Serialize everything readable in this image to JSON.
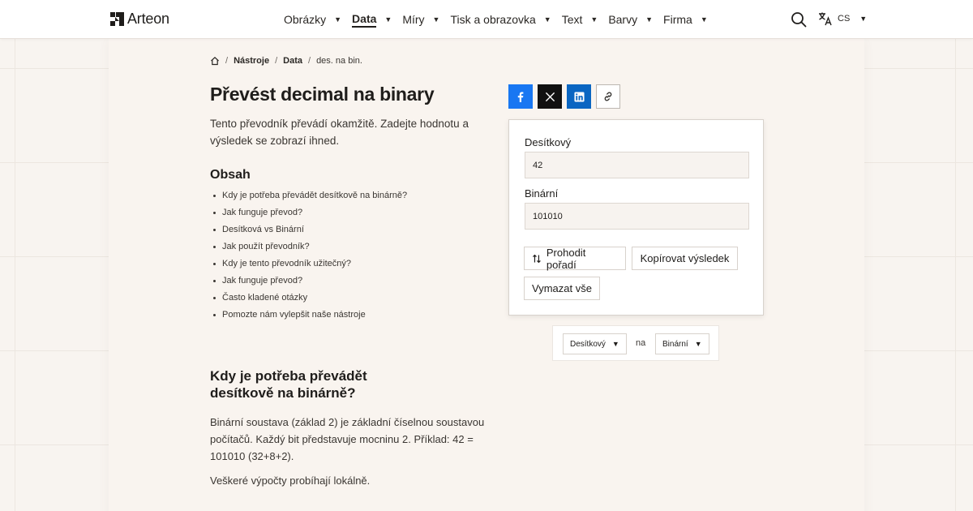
{
  "brand": {
    "name": "Arteon"
  },
  "nav": {
    "items": [
      {
        "label": "Obrázky",
        "active": false
      },
      {
        "label": "Data",
        "active": true
      },
      {
        "label": "Míry",
        "active": false
      },
      {
        "label": "Tisk a obrazovka",
        "active": false
      },
      {
        "label": "Text",
        "active": false
      },
      {
        "label": "Barvy",
        "active": false
      },
      {
        "label": "Firma",
        "active": false
      }
    ],
    "caret": "▼"
  },
  "lang": {
    "code": "CS",
    "caret": "▼"
  },
  "breadcrumb": {
    "sep": "/",
    "items": [
      "Nástroje",
      "Data"
    ],
    "current": "des. na bin."
  },
  "page": {
    "title": "Převést decimal na binary",
    "intro": "Tento převodník převádí okamžitě. Zadejte hodnotu a výsledek se zobrazí ihned."
  },
  "toc": {
    "heading": "Obsah",
    "items": [
      "Kdy je potřeba převádět desítkově na binárně?",
      "Jak funguje převod?",
      "Desítková vs Binární",
      "Jak použít převodník?",
      "Kdy je tento převodník užitečný?",
      "Jak funguje převod?",
      "Často kladené otázky",
      "Pomozte nám vylepšit naše nástroje"
    ]
  },
  "section": {
    "heading": "Kdy je potřeba převádět desítkově na binárně?",
    "body": "Binární soustava (základ 2) je základní číselnou soustavou počítačů. Každý bit představuje mocninu 2. Příklad: 42 = 101010 (32+8+2).",
    "note": "Veškeré výpočty probíhají lokálně."
  },
  "converter": {
    "from_label": "Desítkový",
    "from_value": "42",
    "to_label": "Binární",
    "to_value": "101010",
    "swap_label": "Prohodit pořadí",
    "copy_label": "Kopírovat výsledek",
    "clear_label": "Vymazat vše"
  },
  "units": {
    "from": "Desítkový",
    "connector": "na",
    "to": "Binární",
    "caret": "▼"
  },
  "colors": {
    "facebook": "#1877f2",
    "x": "#111111",
    "linkedin": "#0a66c2",
    "background": "#f8f4f0"
  }
}
